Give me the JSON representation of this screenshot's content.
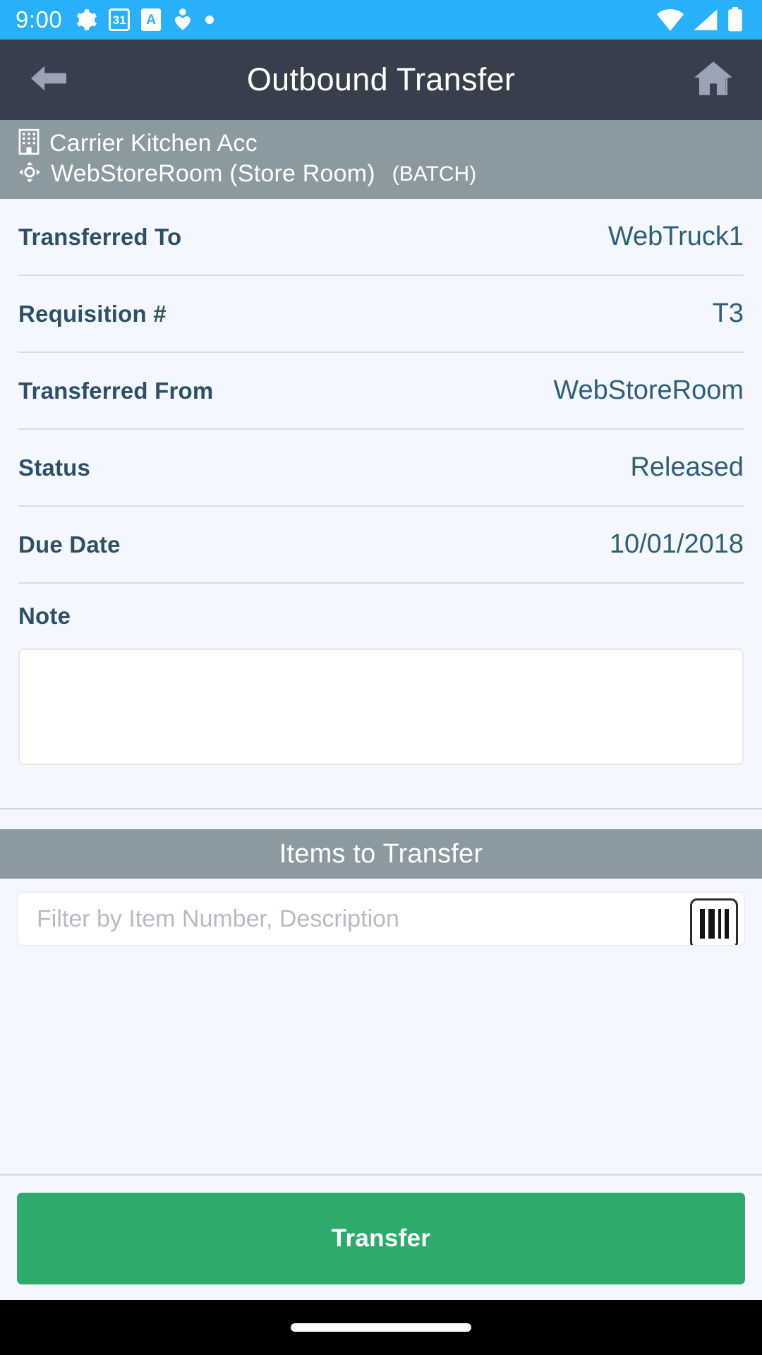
{
  "status_bar": {
    "time": "9:00",
    "left_icons": [
      "gear-icon",
      "calendar-31-icon",
      "a-badge-icon",
      "person-heart-icon",
      "dot-icon"
    ],
    "calendar_day": "31",
    "a_badge_letter": "A",
    "right_icons": [
      "wifi-icon",
      "cellular-signal-icon",
      "battery-icon"
    ],
    "background_color": "#29b0fb"
  },
  "app_bar": {
    "title": "Outbound Transfer",
    "back_icon": "back-arrow-icon",
    "home_icon": "home-icon",
    "background_color": "#373f4d"
  },
  "location_bar": {
    "company": "Carrier Kitchen Acc",
    "company_icon": "building-icon",
    "location": "WebStoreRoom (Store Room)",
    "location_icon": "move-crosshair-icon",
    "mode": "(BATCH)",
    "background_color": "#8b99a1"
  },
  "form": {
    "fields": [
      {
        "label": "Transferred To",
        "value": "WebTruck1"
      },
      {
        "label": "Requisition #",
        "value": "T3"
      },
      {
        "label": "Transferred From",
        "value": "WebStoreRoom"
      },
      {
        "label": "Status",
        "value": "Released"
      },
      {
        "label": "Due Date",
        "value": "10/01/2018"
      }
    ],
    "note": {
      "label": "Note",
      "value": "",
      "placeholder": ""
    }
  },
  "items_section": {
    "header": "Items to Transfer",
    "filter": {
      "value": "",
      "placeholder": "Filter by Item Number, Description"
    },
    "scan_icon": "barcode-scan-icon",
    "rows": []
  },
  "action_bar": {
    "transfer_label": "Transfer",
    "transfer_color": "#2cab6d"
  },
  "nav_bar": {
    "home_indicator": "home-indicator-pill"
  }
}
